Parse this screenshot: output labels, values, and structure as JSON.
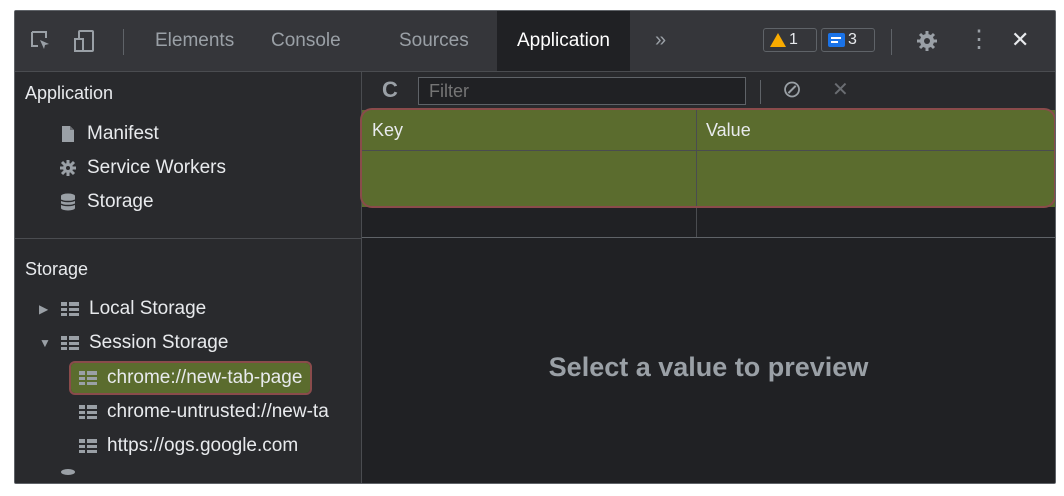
{
  "toolbar": {
    "tabs": [
      "Elements",
      "Console",
      "Sources",
      "Application"
    ],
    "active_tab": "Application",
    "more": "»",
    "warnings_count": "1",
    "messages_count": "3",
    "kebab": "⋮",
    "close": "✕"
  },
  "sidebar": {
    "application_header": "Application",
    "application_items": [
      "Manifest",
      "Service Workers",
      "Storage"
    ],
    "storage_header": "Storage",
    "storage_items": [
      "Local Storage",
      "Session Storage"
    ],
    "session_children": [
      "chrome://new-tab-page",
      "chrome-untrusted://new-ta",
      "https://ogs.google.com"
    ],
    "selected_item": "chrome://new-tab-page",
    "expand_collapsed": "▶",
    "expand_open": "▼"
  },
  "main": {
    "filter_placeholder": "Filter",
    "refresh_icon": "C",
    "block_icon": "⊘",
    "clear_icon": "✕",
    "columns": [
      "Key",
      "Value"
    ],
    "preview_message": "Select a value to preview"
  },
  "colors": {
    "highlight": "#5b6c2e",
    "highlight_border": "#8a4b4b",
    "warning": "#f9ab00",
    "info": "#1a73e8"
  }
}
